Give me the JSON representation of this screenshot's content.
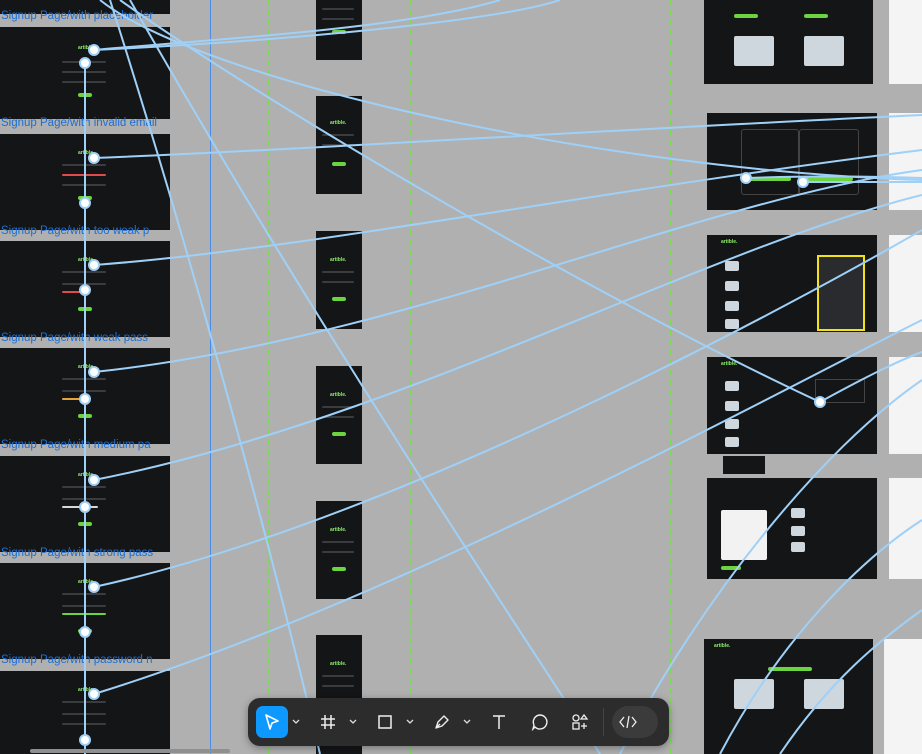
{
  "canvas": {
    "frame_labels": [
      "Signup Page/with placeholder",
      "Signup Page/with invalid email",
      "Signup Page/with too weak p",
      "Signup Page/with weak pass",
      "Signup Page/with medium pa",
      "Signup Page/with strong pass",
      "Signup Page/with password n"
    ],
    "brand_text": "artible."
  },
  "toolbar": {
    "tools": [
      {
        "name": "move-tool",
        "icon": "cursor-icon",
        "active": true
      },
      {
        "name": "frame-tool",
        "icon": "frame-hash-icon",
        "active": false
      },
      {
        "name": "shape-tool",
        "icon": "rectangle-icon",
        "active": false
      },
      {
        "name": "pen-tool",
        "icon": "pen-icon",
        "active": false
      },
      {
        "name": "text-tool",
        "icon": "text-icon",
        "active": false
      },
      {
        "name": "comment-tool",
        "icon": "comment-bubble-icon",
        "active": false
      },
      {
        "name": "actions-tool",
        "icon": "shapes-plus-icon",
        "active": false
      },
      {
        "name": "dev-mode-toggle",
        "icon": "code-brackets-icon",
        "active": false
      }
    ],
    "accent_color": "#0d99ff"
  },
  "colors": {
    "canvas_bg": "#b0b0b0",
    "connector": "#9fd0f7",
    "guide_dashed": "#7ed957",
    "label_blue": "#1c6fd6"
  }
}
